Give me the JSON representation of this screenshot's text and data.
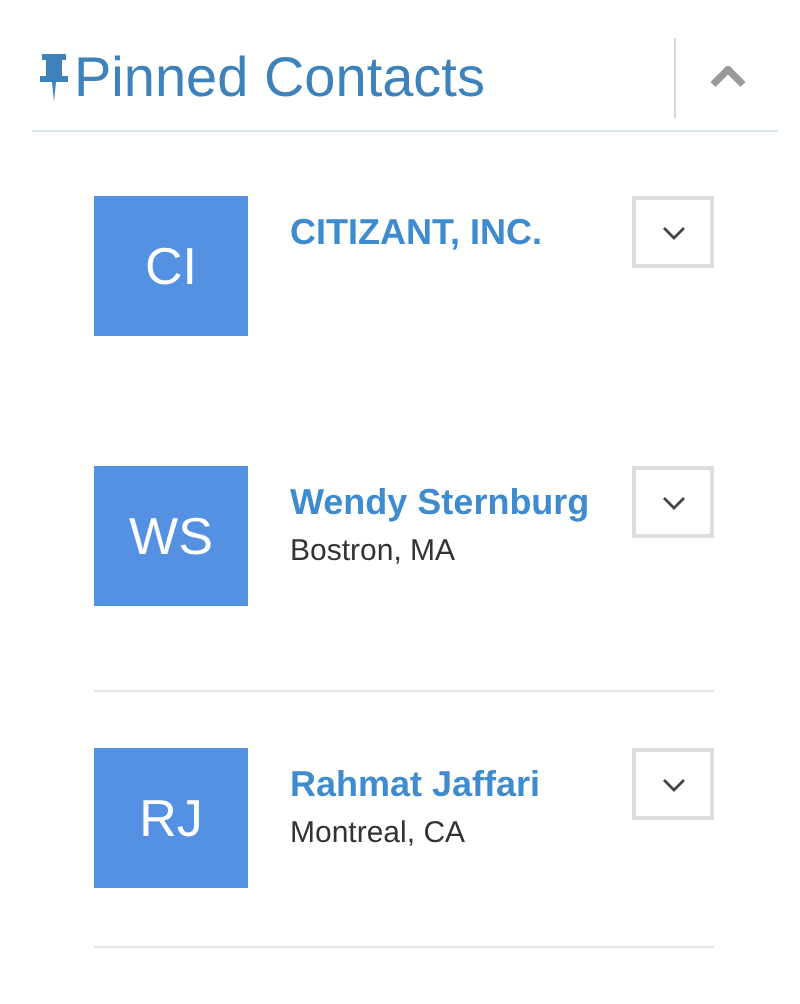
{
  "header": {
    "title": "Pinned Contacts",
    "expanded": true
  },
  "contacts": [
    {
      "initials": "CI",
      "name": "CITIZANT, INC."
    },
    {
      "initials": "WS",
      "name": "Wendy Sternburg",
      "location": "Bostron, MA"
    },
    {
      "initials": "RJ",
      "name": "Rahmat Jaffari",
      "location": "Montreal, CA"
    }
  ]
}
